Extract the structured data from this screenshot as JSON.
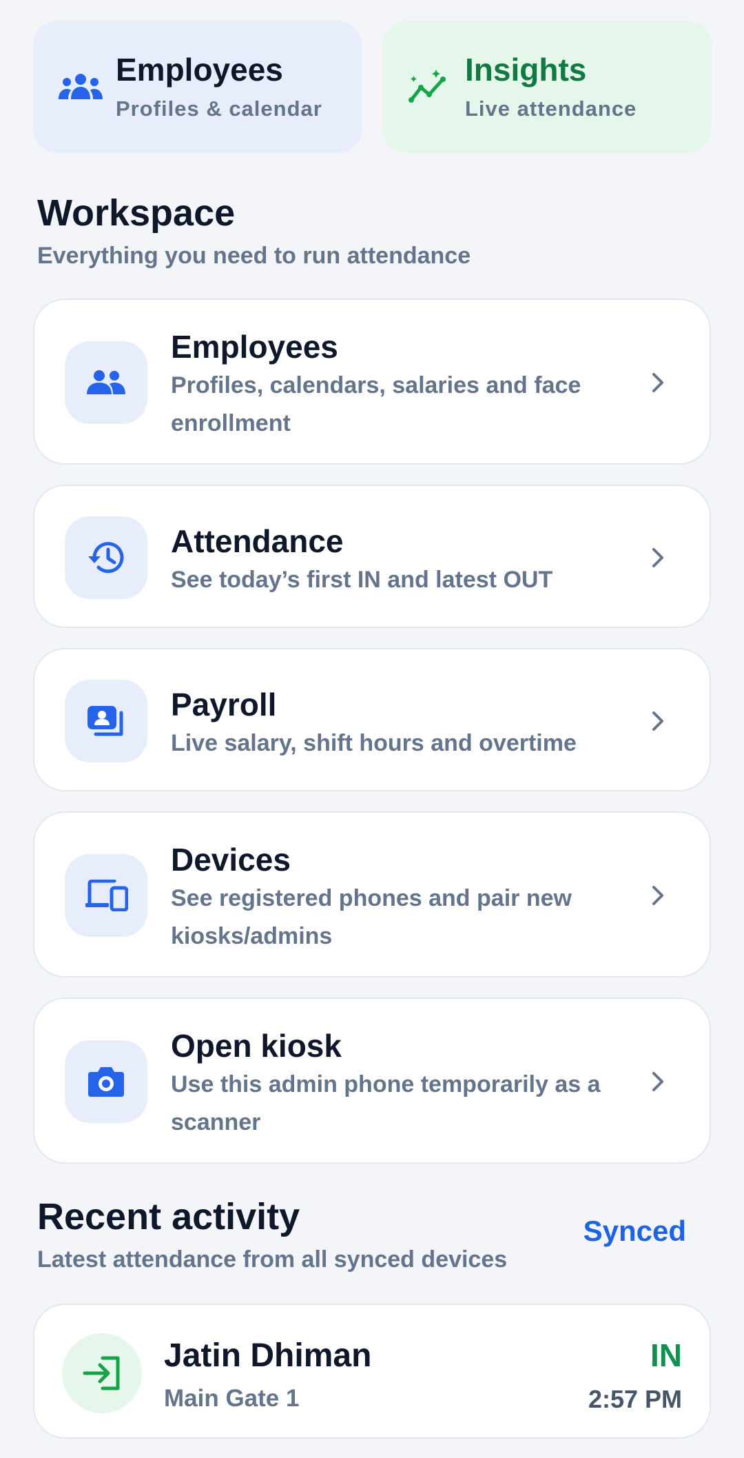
{
  "quick_tiles": {
    "employees": {
      "title": "Employees",
      "subtitle": "Profiles & calendar",
      "icon": "people-icon"
    },
    "insights": {
      "title": "Insights",
      "subtitle": "Live attendance",
      "icon": "sparkle-chart-icon"
    }
  },
  "workspace": {
    "title": "Workspace",
    "subtitle": "Everything you need to run attendance",
    "items": [
      {
        "title": "Employees",
        "desc": "Profiles, calendars, salaries and face enrollment",
        "icon": "people-icon"
      },
      {
        "title": "Attendance",
        "desc": "See today’s first IN and latest OUT",
        "icon": "history-clock-icon"
      },
      {
        "title": "Payroll",
        "desc": "Live salary, shift hours and overtime",
        "icon": "payroll-card-icon"
      },
      {
        "title": "Devices",
        "desc": "See registered phones and pair new kiosks/admins",
        "icon": "devices-icon"
      },
      {
        "title": "Open kiosk",
        "desc": "Use this admin phone temporarily as a scanner",
        "icon": "camera-icon"
      }
    ]
  },
  "recent": {
    "title": "Recent activity",
    "subtitle": "Latest attendance from all synced devices",
    "sync_status": "Synced",
    "entries": [
      {
        "name": "Jatin Dhiman",
        "location": "Main Gate 1",
        "status": "IN",
        "time": "2:57 PM",
        "icon": "login-icon"
      }
    ]
  },
  "colors": {
    "accent_blue": "#1d63ea",
    "accent_green": "#11904f",
    "icon_bg_blue": "#e7edfb",
    "icon_bg_green": "#e5f6ea"
  }
}
